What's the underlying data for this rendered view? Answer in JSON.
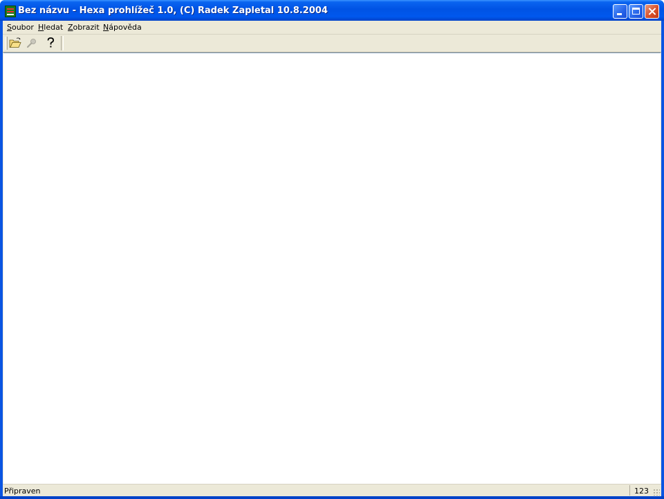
{
  "window": {
    "title": "Bez názvu - Hexa prohlížeč 1.0, (C) Radek Zapletal 10.8.2004",
    "icon": "app-icon",
    "controls": [
      "minimize-icon",
      "maximize-icon",
      "close-icon"
    ]
  },
  "menu": {
    "items": [
      {
        "mnemonic": "S",
        "rest": "oubor"
      },
      {
        "mnemonic": "H",
        "rest": "ledat"
      },
      {
        "mnemonic": "Z",
        "rest": "obrazit"
      },
      {
        "mnemonic": "N",
        "rest": "ápověda"
      }
    ]
  },
  "toolbar": {
    "buttons": [
      {
        "icon": "open-folder-icon",
        "enabled": true
      },
      {
        "icon": "find-icon",
        "enabled": false
      },
      {
        "icon": "help-icon",
        "enabled": true
      }
    ]
  },
  "status": {
    "text": "Připraven",
    "pane": "123"
  },
  "colors": {
    "titlebar": "#0054e3",
    "face": "#ece9d8",
    "content": "#ffffff"
  }
}
